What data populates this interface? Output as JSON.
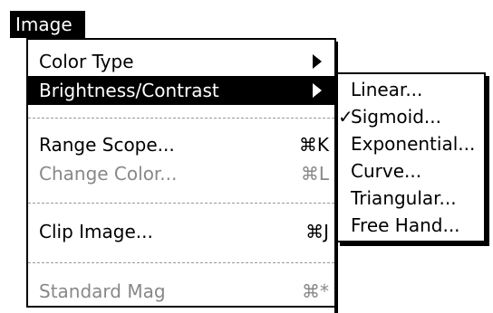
{
  "menubar": {
    "title": "Image"
  },
  "menu": {
    "items": [
      {
        "label": "Color Type",
        "shortcut": ""
      },
      {
        "label": "Brightness/Contrast",
        "shortcut": ""
      },
      {
        "label": "Range Scope...",
        "shortcut": "⌘K"
      },
      {
        "label": "Change Color...",
        "shortcut": "⌘L"
      },
      {
        "label": "Clip Image...",
        "shortcut": "⌘J"
      },
      {
        "label": "Standard Mag",
        "shortcut": "⌘*"
      }
    ]
  },
  "submenu": {
    "check_mark": "✓",
    "items": [
      {
        "label": "Linear..."
      },
      {
        "label": "Sigmoid..."
      },
      {
        "label": "Exponential..."
      },
      {
        "label": "Curve..."
      },
      {
        "label": "Triangular..."
      },
      {
        "label": "Free Hand..."
      }
    ]
  },
  "colors": {
    "selected_bg": "#000000",
    "disabled_text": "#888888"
  }
}
